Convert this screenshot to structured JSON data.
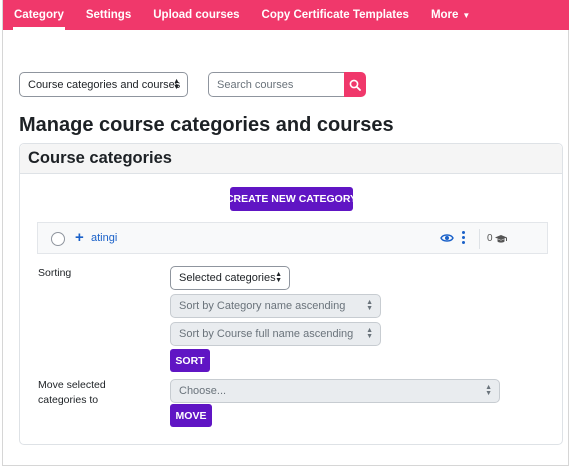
{
  "nav": {
    "items": [
      {
        "label": "Category",
        "active": true
      },
      {
        "label": "Settings",
        "active": false
      },
      {
        "label": "Upload courses",
        "active": false
      },
      {
        "label": "Copy Certificate Templates",
        "active": false
      },
      {
        "label": "More",
        "active": false,
        "has_dropdown": true
      }
    ]
  },
  "view_select": {
    "value": "Course categories and courses"
  },
  "search": {
    "placeholder": "Search courses",
    "icon": "search-icon"
  },
  "page_title": "Manage course categories and courses",
  "card": {
    "title": "Course categories"
  },
  "create_button": {
    "label": "CREATE NEW CATEGORY"
  },
  "category": {
    "name": "atingi",
    "course_count": "0",
    "icons": [
      "expand-plus-icon",
      "eye-icon",
      "kebab-menu-icon",
      "graduation-cap-icon"
    ]
  },
  "sorting": {
    "label": "Sorting",
    "scope_select": "Selected categories",
    "category_sort": "Sort by Category name ascending",
    "course_sort": "Sort by Course full name ascending",
    "button": "SORT"
  },
  "move": {
    "label_line1": "Move selected",
    "label_line2": "categories to",
    "select": "Choose...",
    "button": "MOVE"
  },
  "colors": {
    "brand": "#f0386b",
    "primary_button": "#6015c4",
    "link": "#1a61c9"
  }
}
